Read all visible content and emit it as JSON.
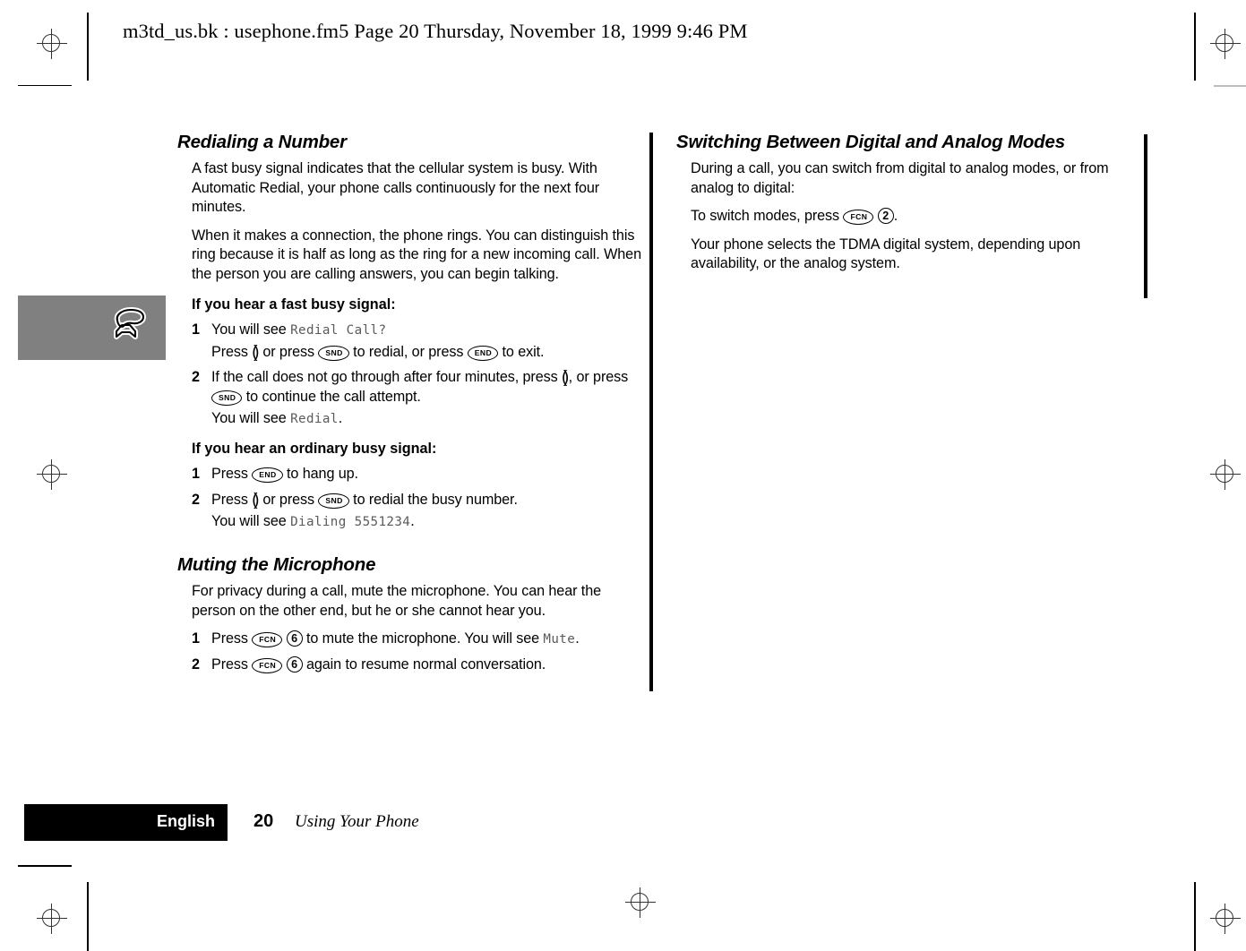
{
  "print_marks": {
    "header_line": "m3td_us.bk : usephone.fm5  Page 20  Thursday, November 18, 1999  9:46 PM"
  },
  "thumb_tab": {
    "icon": "phone-handset-offhook-icon"
  },
  "left_column": {
    "section_1": {
      "heading": "Redialing a Number",
      "paragraphs": [
        "A fast busy signal indicates that the cellular system is busy. With Automatic Redial, your phone calls continuously for the next four minutes.",
        "When it makes a connection, the phone rings. You can distinguish this ring because it is half as long as the ring for a new incoming call. When the person you are calling answers, you can begin talking."
      ],
      "subhead_1": "If you hear a fast busy signal:",
      "steps_1": [
        {
          "num": "1",
          "text_a": "You will see ",
          "lcd": "Redial Call?",
          "sub_a": "Press ",
          "key_rocker": "()",
          "sub_b": " or press ",
          "key_snd": "SND",
          "sub_c": " to redial, or press ",
          "key_end": "END",
          "sub_d": " to exit."
        },
        {
          "num": "2",
          "text_a": "If the call does not go through after four minutes, press ",
          "key_rocker": "()",
          "text_b": ", or press ",
          "key_snd": "SND",
          "text_c": " to continue the call attempt.",
          "sub_a": "You will see ",
          "lcd": "Redial",
          "sub_b": "."
        }
      ],
      "subhead_2": "If you hear an ordinary busy signal:",
      "steps_2": [
        {
          "num": "1",
          "text_a": "Press ",
          "key_end": "END",
          "text_b": " to hang up."
        },
        {
          "num": "2",
          "text_a": "Press ",
          "key_rocker": "()",
          "text_b": " or press ",
          "key_snd": "SND",
          "text_c": " to redial the busy number.",
          "sub_a": "You will see ",
          "lcd": "Dialing 5551234",
          "sub_b": "."
        }
      ]
    },
    "section_2": {
      "heading": "Muting the Microphone",
      "paragraph": "For privacy during a call, mute the microphone. You can hear the person on the other end, but he or she cannot hear you.",
      "steps": [
        {
          "num": "1",
          "text_a": "Press ",
          "key_fcn": "FCN",
          "key_digit": "6",
          "text_b": " to mute the microphone. You will see ",
          "lcd": "Mute",
          "text_c": "."
        },
        {
          "num": "2",
          "text_a": "Press ",
          "key_fcn": "FCN",
          "key_digit": "6",
          "text_b": " again to resume normal conversation."
        }
      ]
    }
  },
  "right_column": {
    "heading": "Switching Between Digital and Analog Modes",
    "paragraph_1": "During a call, you can switch from digital to analog modes, or from analog to digital:",
    "switch_line": {
      "text_a": "To switch modes, press ",
      "key_fcn": "FCN",
      "key_digit": "2",
      "text_b": "."
    },
    "paragraph_2": "Your phone selects the TDMA digital system, depending upon availability, or the analog system."
  },
  "footer": {
    "language_tab": "English",
    "page_number": "20",
    "chapter_title": "Using Your Phone"
  },
  "colors": {
    "thumb_tab_gray": "#808080",
    "footer_tab_black": "#000000",
    "lcd_gray": "#5a5a5a"
  }
}
